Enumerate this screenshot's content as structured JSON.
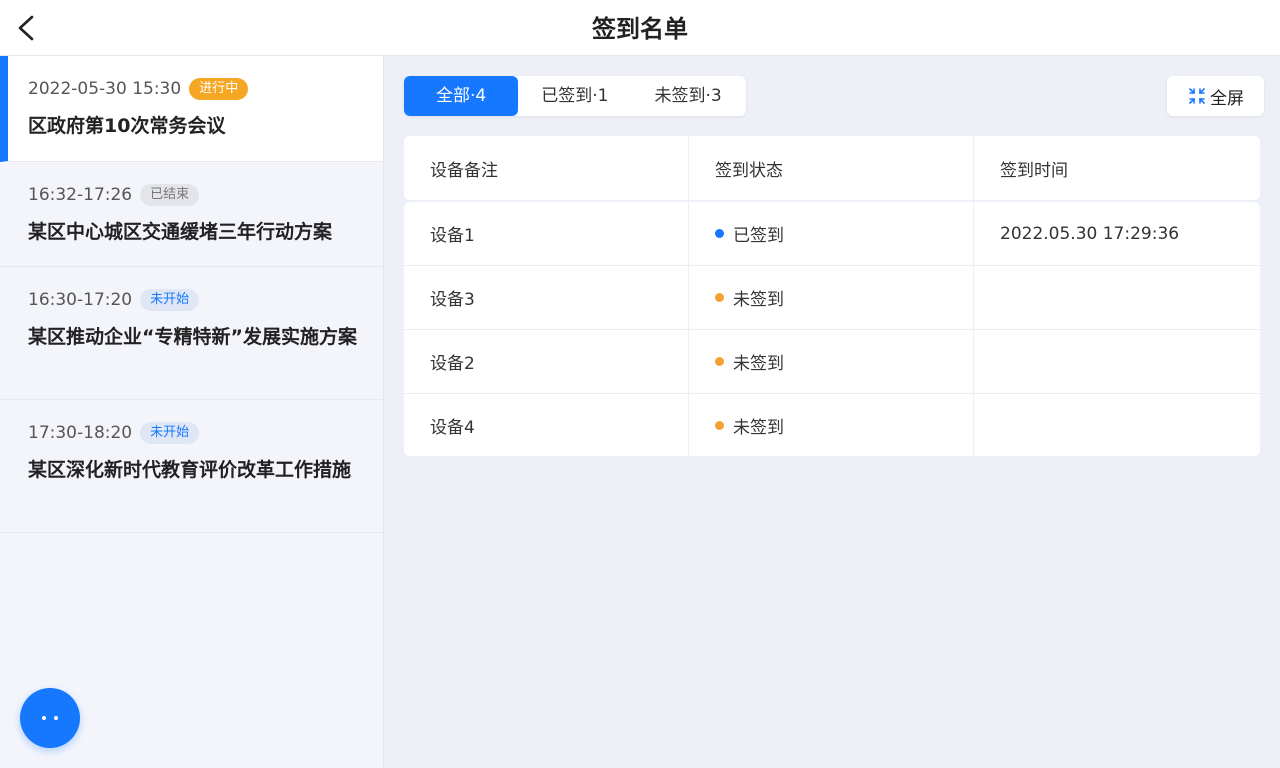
{
  "header": {
    "title": "签到名单"
  },
  "sidebar": {
    "meetings": [
      {
        "time": "2022-05-30 15:30",
        "status": "进行中",
        "title": "区政府第10次常务会议"
      },
      {
        "time": "16:32-17:26",
        "status": "已结束",
        "title": "某区中心城区交通缓堵三年行动方案"
      },
      {
        "time": "16:30-17:20",
        "status": "未开始",
        "title": "某区推动企业“专精特新”发展实施方案"
      },
      {
        "time": "17:30-18:20",
        "status": "未开始",
        "title": "某区深化新时代教育评价改革工作措施"
      }
    ]
  },
  "tabs": [
    {
      "label": "全部·4"
    },
    {
      "label": "已签到·1"
    },
    {
      "label": "未签到·3"
    }
  ],
  "fullscreen": {
    "label": "全屏",
    "icon": "fullscreen-icon"
  },
  "table": {
    "headers": [
      "设备备注",
      "签到状态",
      "签到时间"
    ],
    "rows": [
      {
        "device": "设备1",
        "status": "已签到",
        "time": "2022.05.30 17:29:36"
      },
      {
        "device": "设备3",
        "status": "未签到",
        "time": ""
      },
      {
        "device": "设备2",
        "status": "未签到",
        "time": ""
      },
      {
        "device": "设备4",
        "status": "未签到",
        "time": ""
      }
    ]
  },
  "colors": {
    "accent": "#1677ff",
    "signed": "#1677ff",
    "unsigned": "#f5a033",
    "ongoing": "#f5a623"
  }
}
